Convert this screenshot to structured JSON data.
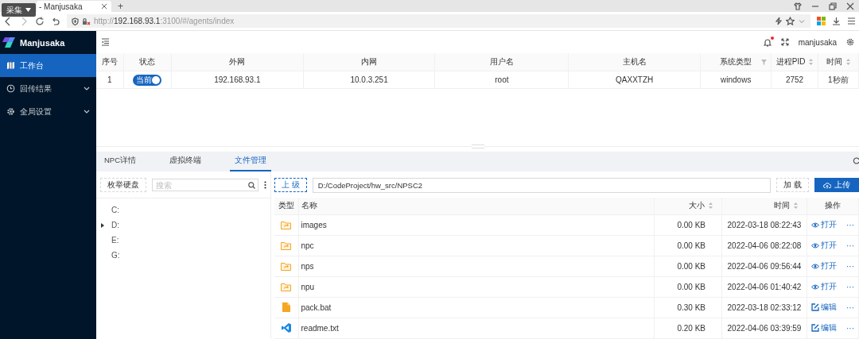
{
  "browser": {
    "overlay_button": "采集",
    "tab_title": "- Manjusaka",
    "new_tab": "+",
    "url": "http://**192.168.93.1**:3100/#/agents/index"
  },
  "sidebar": {
    "brand": "Manjusaka",
    "items": [
      {
        "label": "工作台",
        "selected": true,
        "kind": "link"
      },
      {
        "label": "回传结果",
        "selected": false,
        "kind": "group"
      },
      {
        "label": "全局设置",
        "selected": false,
        "kind": "group"
      }
    ]
  },
  "header": {
    "username": "manjusaka",
    "notification": true
  },
  "agents_table": {
    "columns": [
      {
        "label": "序号",
        "kind": "plain"
      },
      {
        "label": "状态",
        "kind": "plain"
      },
      {
        "label": "外网",
        "kind": "plain"
      },
      {
        "label": "内网",
        "kind": "plain"
      },
      {
        "label": "用户名",
        "kind": "plain"
      },
      {
        "label": "主机名",
        "kind": "plain"
      },
      {
        "label": "系统类型",
        "kind": "filter"
      },
      {
        "label": "进程PID",
        "kind": "sort"
      },
      {
        "label": "时间",
        "kind": "sort"
      }
    ],
    "rows": [
      {
        "index": "1",
        "status": {
          "label": "当前",
          "on": true
        },
        "external": "192.168.93.1",
        "internal": "10.0.3.251",
        "user": "root",
        "host": "QAXXTZH",
        "os": "windows",
        "pid": "2752",
        "time": "1秒前"
      }
    ]
  },
  "tabs": [
    {
      "label": "NPC详情",
      "selected": false
    },
    {
      "label": "虚拟终端",
      "selected": false
    },
    {
      "label": "文件管理",
      "selected": true
    }
  ],
  "file_manager": {
    "enumerate_button": "枚举硬盘",
    "search_placeholder": "搜索",
    "drives": [
      {
        "label": "C:",
        "kind": "leaf"
      },
      {
        "label": "D:",
        "kind": "branch"
      },
      {
        "label": "E:",
        "kind": "leaf"
      },
      {
        "label": "G:",
        "kind": "leaf"
      }
    ],
    "up_button": "上 级",
    "path": "D:/CodeProject/hw_src/NPSC2",
    "load_button": "加 载",
    "upload_button": "上传",
    "columns": [
      {
        "label": "类型",
        "kind": "plain"
      },
      {
        "label": "名称",
        "kind": "plain"
      },
      {
        "label": "大小",
        "kind": "sort"
      },
      {
        "label": "时间",
        "kind": "sort"
      },
      {
        "label": "操作",
        "kind": "plain"
      }
    ],
    "files": [
      {
        "kind": "folder",
        "name": "images",
        "size": "0.00 KB",
        "time": "2022-03-18 08:22:43",
        "action": {
          "kind": "open",
          "label": "打开"
        },
        "more": "···"
      },
      {
        "kind": "folder",
        "name": "npc",
        "size": "0.00 KB",
        "time": "2022-04-06 08:22:08",
        "action": {
          "kind": "open",
          "label": "打开"
        },
        "more": "···"
      },
      {
        "kind": "folder",
        "name": "nps",
        "size": "0.00 KB",
        "time": "2022-04-06 09:56:44",
        "action": {
          "kind": "open",
          "label": "打开"
        },
        "more": "···"
      },
      {
        "kind": "folder",
        "name": "npu",
        "size": "0.00 KB",
        "time": "2022-04-06 01:40:42",
        "action": {
          "kind": "open",
          "label": "打开"
        },
        "more": "···"
      },
      {
        "kind": "file",
        "name": "pack.bat",
        "size": "0.30 KB",
        "time": "2022-03-18 02:33:12",
        "action": {
          "kind": "edit",
          "label": "编辑"
        },
        "more": "···"
      },
      {
        "kind": "code",
        "name": "readme.txt",
        "size": "0.20 KB",
        "time": "2022-04-06 03:39:59",
        "action": {
          "kind": "edit",
          "label": "编辑"
        },
        "more": "···"
      }
    ]
  }
}
